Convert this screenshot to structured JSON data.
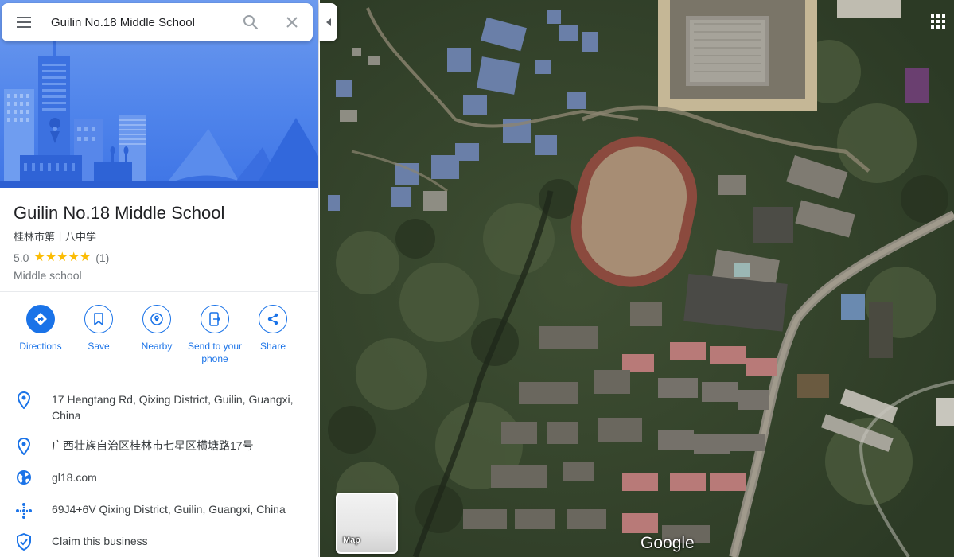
{
  "search": {
    "value": "Guilin No.18 Middle School",
    "menu_icon": "menu-icon",
    "search_icon": "search-icon",
    "clear_icon": "close-icon"
  },
  "place": {
    "title": "Guilin No.18 Middle School",
    "subtitle": "桂林市第十八中学",
    "rating": "5.0",
    "stars": "★★★★★",
    "review_count": "(1)",
    "category": "Middle school"
  },
  "actions": [
    {
      "label": "Directions",
      "icon": "directions-icon"
    },
    {
      "label": "Save",
      "icon": "bookmark-icon"
    },
    {
      "label": "Nearby",
      "icon": "nearby-icon"
    },
    {
      "label": "Send to your phone",
      "icon": "send-to-phone-icon"
    },
    {
      "label": "Share",
      "icon": "share-icon"
    }
  ],
  "info": [
    {
      "text": "17 Hengtang Rd, Qixing District, Guilin, Guangxi, China",
      "icon": "location-pin-icon"
    },
    {
      "text": "广西壮族自治区桂林市七星区横塘路17号",
      "icon": "location-pin-icon"
    },
    {
      "text": "gl18.com",
      "icon": "globe-icon"
    },
    {
      "text": "69J4+6V Qixing District, Guilin, Guangxi, China",
      "icon": "plus-code-icon"
    },
    {
      "text": "Claim this business",
      "icon": "shield-check-icon"
    }
  ],
  "map": {
    "layer_toggle_label": "Map",
    "logo": "Google",
    "apps_icon": "apps-grid-icon",
    "collapse_icon": "caret-left-icon"
  },
  "colors": {
    "accent": "#1a73e8",
    "star": "#fbbc04",
    "hero": "#4f84eb"
  }
}
